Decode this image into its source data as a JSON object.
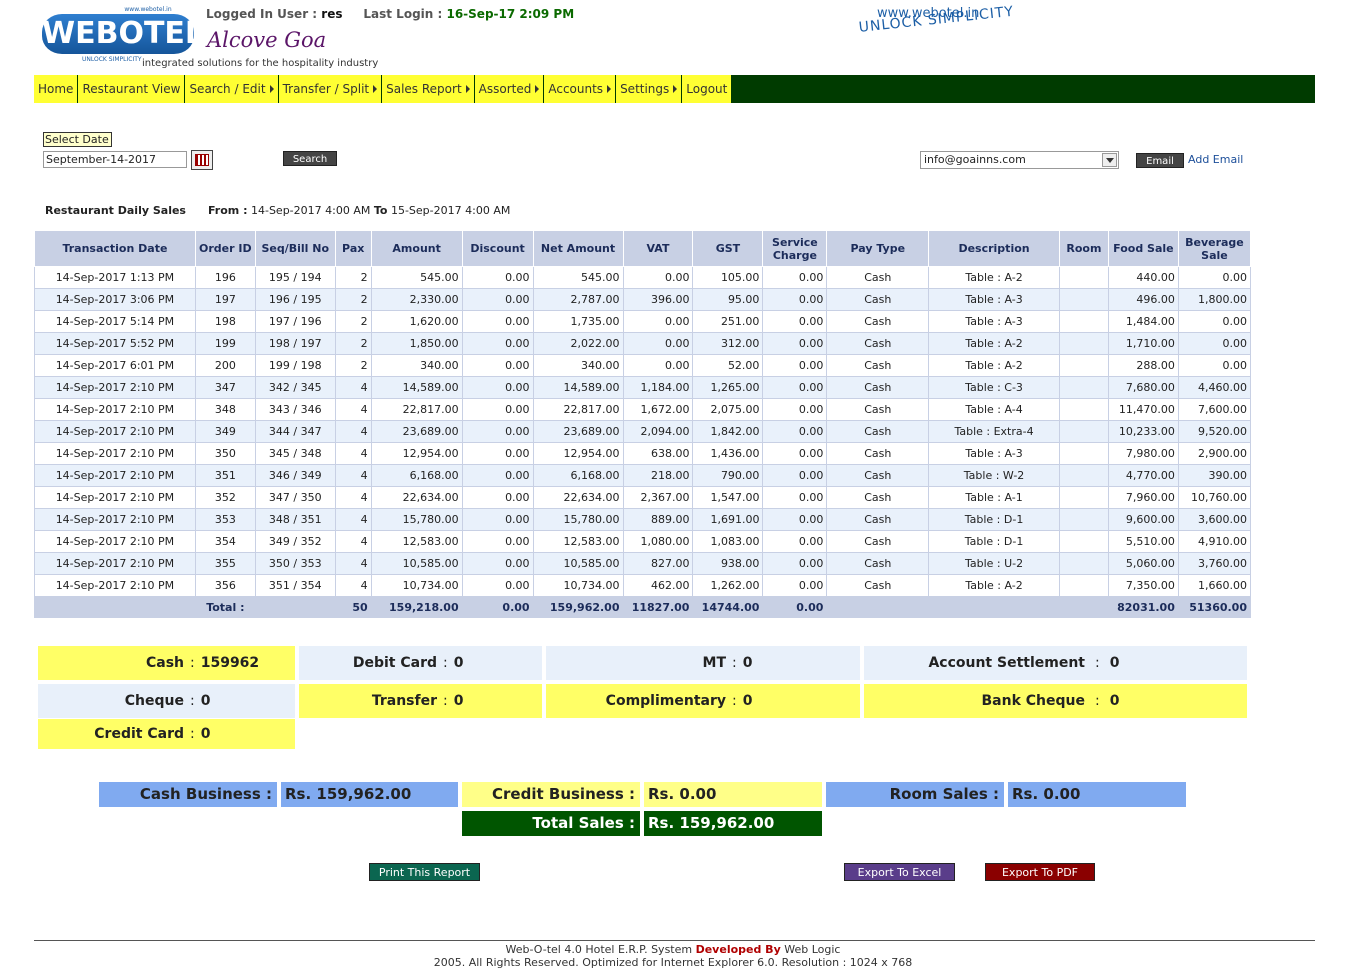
{
  "header": {
    "logo_small": "www.webotel.in",
    "logo_text": "WEBOTEL",
    "logo_sub": "UNLOCK SIMPLICITY",
    "logged_in_label": "Logged In User :",
    "logged_in_user": "res",
    "last_login_label": "Last Login :",
    "last_login": "16-Sep-17 2:09 PM",
    "hotel_name": "Alcove Goa",
    "tagline": "integrated solutions for the hospitality industry",
    "site_url": "www.webotel.in",
    "slogan": "UNLOCK SIMPLICITY"
  },
  "nav": [
    {
      "label": "Home",
      "caret": false
    },
    {
      "label": "Restaurant View",
      "caret": false
    },
    {
      "label": "Search / Edit",
      "caret": true
    },
    {
      "label": "Transfer / Split",
      "caret": true
    },
    {
      "label": "Sales Report",
      "caret": true
    },
    {
      "label": "Assorted",
      "caret": true
    },
    {
      "label": "Accounts",
      "caret": true
    },
    {
      "label": "Settings",
      "caret": true
    },
    {
      "label": "Logout",
      "caret": false
    }
  ],
  "controls": {
    "select_date_label": "Select Date",
    "date_value": "September-14-2017",
    "search_label": "Search",
    "email_value": "info@goainns.com",
    "email_button": "Email",
    "add_email": "Add Email"
  },
  "report": {
    "title": "Restaurant Daily Sales",
    "from_label": "From :",
    "from": "14-Sep-2017 4:00 AM",
    "to_label": "To",
    "to": "15-Sep-2017 4:00 AM"
  },
  "table": {
    "headers": [
      "Transaction Date",
      "Order ID",
      "Seq/Bill No",
      "Pax",
      "Amount",
      "Discount",
      "Net Amount",
      "VAT",
      "GST",
      "Service Charge",
      "Pay Type",
      "Description",
      "Room",
      "Food Sale",
      "Beverage Sale"
    ],
    "rows": [
      [
        "14-Sep-2017 1:13 PM",
        "196",
        "195 / 194",
        "2",
        "545.00",
        "0.00",
        "545.00",
        "0.00",
        "105.00",
        "0.00",
        "Cash",
        "Table : A-2",
        "",
        "440.00",
        "0.00"
      ],
      [
        "14-Sep-2017 3:06 PM",
        "197",
        "196 / 195",
        "2",
        "2,330.00",
        "0.00",
        "2,787.00",
        "396.00",
        "95.00",
        "0.00",
        "Cash",
        "Table : A-3",
        "",
        "496.00",
        "1,800.00"
      ],
      [
        "14-Sep-2017 5:14 PM",
        "198",
        "197 / 196",
        "2",
        "1,620.00",
        "0.00",
        "1,735.00",
        "0.00",
        "251.00",
        "0.00",
        "Cash",
        "Table : A-3",
        "",
        "1,484.00",
        "0.00"
      ],
      [
        "14-Sep-2017 5:52 PM",
        "199",
        "198 / 197",
        "2",
        "1,850.00",
        "0.00",
        "2,022.00",
        "0.00",
        "312.00",
        "0.00",
        "Cash",
        "Table : A-2",
        "",
        "1,710.00",
        "0.00"
      ],
      [
        "14-Sep-2017 6:01 PM",
        "200",
        "199 / 198",
        "2",
        "340.00",
        "0.00",
        "340.00",
        "0.00",
        "52.00",
        "0.00",
        "Cash",
        "Table : A-2",
        "",
        "288.00",
        "0.00"
      ],
      [
        "14-Sep-2017 2:10 PM",
        "347",
        "342 / 345",
        "4",
        "14,589.00",
        "0.00",
        "14,589.00",
        "1,184.00",
        "1,265.00",
        "0.00",
        "Cash",
        "Table : C-3",
        "",
        "7,680.00",
        "4,460.00"
      ],
      [
        "14-Sep-2017 2:10 PM",
        "348",
        "343 / 346",
        "4",
        "22,817.00",
        "0.00",
        "22,817.00",
        "1,672.00",
        "2,075.00",
        "0.00",
        "Cash",
        "Table : A-4",
        "",
        "11,470.00",
        "7,600.00"
      ],
      [
        "14-Sep-2017 2:10 PM",
        "349",
        "344 / 347",
        "4",
        "23,689.00",
        "0.00",
        "23,689.00",
        "2,094.00",
        "1,842.00",
        "0.00",
        "Cash",
        "Table : Extra-4",
        "",
        "10,233.00",
        "9,520.00"
      ],
      [
        "14-Sep-2017 2:10 PM",
        "350",
        "345 / 348",
        "4",
        "12,954.00",
        "0.00",
        "12,954.00",
        "638.00",
        "1,436.00",
        "0.00",
        "Cash",
        "Table : A-3",
        "",
        "7,980.00",
        "2,900.00"
      ],
      [
        "14-Sep-2017 2:10 PM",
        "351",
        "346 / 349",
        "4",
        "6,168.00",
        "0.00",
        "6,168.00",
        "218.00",
        "790.00",
        "0.00",
        "Cash",
        "Table : W-2",
        "",
        "4,770.00",
        "390.00"
      ],
      [
        "14-Sep-2017 2:10 PM",
        "352",
        "347 / 350",
        "4",
        "22,634.00",
        "0.00",
        "22,634.00",
        "2,367.00",
        "1,547.00",
        "0.00",
        "Cash",
        "Table : A-1",
        "",
        "7,960.00",
        "10,760.00"
      ],
      [
        "14-Sep-2017 2:10 PM",
        "353",
        "348 / 351",
        "4",
        "15,780.00",
        "0.00",
        "15,780.00",
        "889.00",
        "1,691.00",
        "0.00",
        "Cash",
        "Table : D-1",
        "",
        "9,600.00",
        "3,600.00"
      ],
      [
        "14-Sep-2017 2:10 PM",
        "354",
        "349 / 352",
        "4",
        "12,583.00",
        "0.00",
        "12,583.00",
        "1,080.00",
        "1,083.00",
        "0.00",
        "Cash",
        "Table : D-1",
        "",
        "5,510.00",
        "4,910.00"
      ],
      [
        "14-Sep-2017 2:10 PM",
        "355",
        "350 / 353",
        "4",
        "10,585.00",
        "0.00",
        "10,585.00",
        "827.00",
        "938.00",
        "0.00",
        "Cash",
        "Table : U-2",
        "",
        "5,060.00",
        "3,760.00"
      ],
      [
        "14-Sep-2017 2:10 PM",
        "356",
        "351 / 354",
        "4",
        "10,734.00",
        "0.00",
        "10,734.00",
        "462.00",
        "1,262.00",
        "0.00",
        "Cash",
        "Table : A-2",
        "",
        "7,350.00",
        "1,660.00"
      ]
    ],
    "total": {
      "label": "Total :",
      "pax": "50",
      "amount": "159,218.00",
      "discount": "0.00",
      "net_amount": "159,962.00",
      "vat": "11827.00",
      "gst": "14744.00",
      "service": "0.00",
      "food": "82031.00",
      "beverage": "51360.00"
    }
  },
  "payments": {
    "cash": {
      "label": "Cash",
      "value": "159962"
    },
    "debit_card": {
      "label": "Debit Card",
      "value": "0"
    },
    "mt": {
      "label": "MT",
      "value": "0"
    },
    "account_settlement": {
      "label": "Account Settlement",
      "value": "0"
    },
    "cheque": {
      "label": "Cheque",
      "value": "0"
    },
    "transfer": {
      "label": "Transfer",
      "value": "0"
    },
    "complimentary": {
      "label": "Complimentary",
      "value": "0"
    },
    "bank_cheque": {
      "label": "Bank Cheque",
      "value": "0"
    },
    "credit_card": {
      "label": "Credit Card",
      "value": "0"
    },
    "separator": ":"
  },
  "business": {
    "cash_label": "Cash Business :",
    "cash_value": "Rs. 159,962.00",
    "credit_label": "Credit Business :",
    "credit_value": "Rs. 0.00",
    "room_label": "Room Sales :",
    "room_value": "Rs. 0.00",
    "total_label": "Total Sales :",
    "total_value": "Rs. 159,962.00"
  },
  "buttons": {
    "print": "Print This Report",
    "excel": "Export To Excel",
    "pdf": "Export To PDF"
  },
  "footer": {
    "line1_a": "Web-O-tel 4.0 Hotel E.R.P. System",
    "line1_dev": "Developed By",
    "line1_b": "Web Logic",
    "line2": "2005. All Rights Reserved. Optimized for Internet Explorer 6.0.  Resolution : 1024 x 768"
  },
  "colors": {
    "nav_bg": "#003b00",
    "nav_item": "#ffff33",
    "table_header": "#c8d0e4",
    "row_alt": "#e9f1fb",
    "yellow_box": "#ffff66",
    "blue_box": "#80aaf0",
    "total_green": "#005500",
    "print_btn": "#0b6650",
    "excel_btn": "#5a3d8a",
    "pdf_btn": "#8a0000"
  }
}
